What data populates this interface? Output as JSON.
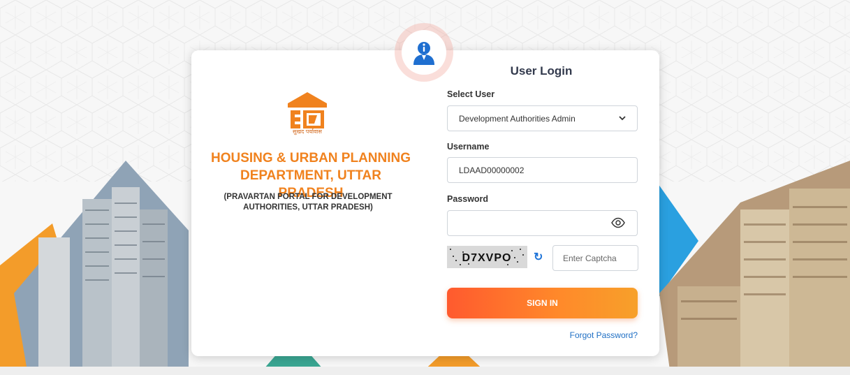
{
  "department": {
    "logo_caption": "सुखद पर्यावास",
    "title_line1": "HOUSING & URBAN PLANNING",
    "title_line2": "DEPARTMENT, UTTAR PRADESH",
    "subtitle_line1": "(PRAVARTAN PORTAL FOR DEVELOPMENT",
    "subtitle_line2": "AUTHORITIES, UTTAR PRADESH)"
  },
  "login": {
    "title": "User Login",
    "select_user_label": "Select User",
    "select_user_value": "Development Authorities Admin",
    "username_label": "Username",
    "username_value": "LDAAD00000002",
    "password_label": "Password",
    "password_value": "",
    "captcha_text": "D7XVPO",
    "captcha_placeholder": "Enter Captcha",
    "signin_label": "SIGN IN",
    "forgot_label": "Forgot Password?"
  },
  "icons": {
    "badge": "user-info-icon",
    "eye": "eye-icon",
    "refresh": "refresh-icon",
    "chevron": "chevron-down-icon"
  },
  "colors": {
    "brand_orange": "#f0821e",
    "signin_gradient_start": "#ff5a2e",
    "signin_gradient_end": "#f7a02a",
    "link_blue": "#1f6fc4",
    "badge_blue": "#1f6fd0"
  }
}
